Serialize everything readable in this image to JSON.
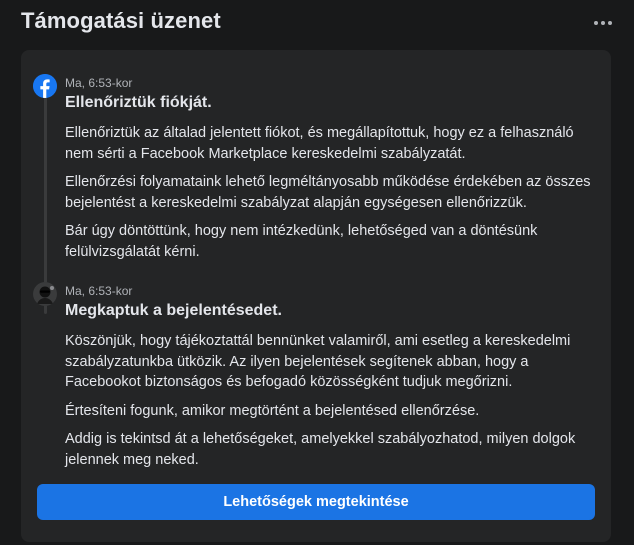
{
  "header": {
    "title": "Támogatási üzenet",
    "more_icon": "more-horizontal-icon"
  },
  "messages": [
    {
      "icon": "facebook-logo-icon",
      "time": "Ma, 6:53-kor",
      "heading": "Ellenőriztük fiókját.",
      "paragraphs": [
        "Ellenőriztük az általad jelentett fiókot, és megállapítottuk, hogy ez a felhasználó nem sérti a Facebook Marketplace kereskedelmi szabályzatát.",
        "Ellenőrzési folyamataink lehető legméltányosabb működése érdekében az összes bejelentést a kereskedelmi szabályzat alapján egységesen ellenőrizzük.",
        "Bár úgy döntöttünk, hogy nem intézkedünk, lehetőséged van a döntésünk felülvizsgálatát kérni."
      ]
    },
    {
      "icon": "user-avatar-icon",
      "time": "Ma, 6:53-kor",
      "heading": "Megkaptuk a bejelentésedet.",
      "paragraphs": [
        "Köszönjük, hogy tájékoztattál bennünket valamiről, ami esetleg a kereskedelmi szabályzatunkba ütközik. Az ilyen bejelentések segítenek abban, hogy a Facebookot biztonságos és befogadó közösségként tudjuk megőrizni.",
        "Értesíteni fogunk, amikor megtörtént a bejelentésed ellenőrzése.",
        "Addig is tekintsd át a lehetőségeket, amelyekkel szabályozhatod, milyen dolgok jelennek meg neked."
      ]
    }
  ],
  "cta": {
    "label": "Lehetőségek megtekintése"
  },
  "colors": {
    "background": "#18191a",
    "card": "#242526",
    "accent": "#1b74e4",
    "facebook_blue": "#1877f2",
    "secondary_text": "#b0b3b8"
  }
}
